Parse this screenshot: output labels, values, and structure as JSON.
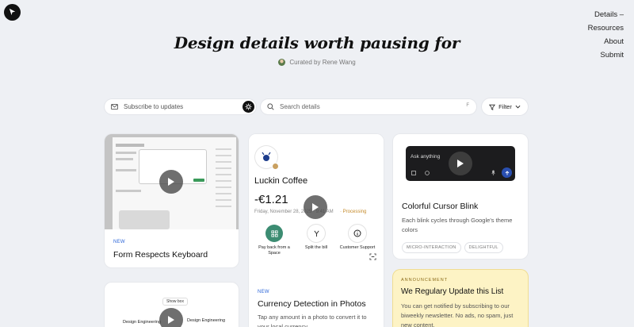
{
  "nav": {
    "details": "Details –",
    "resources": "Resources",
    "about": "About",
    "submit": "Submit"
  },
  "hero": {
    "title": "Design details worth pausing for",
    "curated": "Curated by Rene Wang"
  },
  "toolbar": {
    "subscribe_placeholder": "Subscribe to updates",
    "search_placeholder": "Search details",
    "search_shortcut": "F",
    "filter_label": "Filter"
  },
  "cards": {
    "form": {
      "badge": "NEW",
      "title": "Form Respects Keyboard"
    },
    "currency": {
      "merchant": "Luckin Coffee",
      "amount": "-€1.21",
      "datetime": "Friday, November 28, 2025 · 9:41 AM",
      "status": "· Processing",
      "actions": [
        "Pay back from a Space",
        "Split the bill",
        "Customer Support"
      ],
      "badge": "NEW",
      "title": "Currency Detection in Photos",
      "desc": "Tap any amount in a photo to convert it to your local currency."
    },
    "cursor": {
      "prompt": "Ask anything",
      "title": "Colorful Cursor Blink",
      "desc": "Each blink cycles through Google's theme colors",
      "tags": [
        "MICRO-INTERACTION",
        "DELIGHTFUL"
      ]
    },
    "announcement": {
      "label": "ANNOUNCEMENT",
      "title": "We Regulary Update this List",
      "desc": "You can get notified by subscribing to our biweekly newsletter. No ads, no spam, just new content."
    },
    "engineering": {
      "show_box": "Show box",
      "label_left": "Design Engineering",
      "label_right": "Design Engineering"
    }
  },
  "colors": {
    "accent_blue": "#2a64d8",
    "announcement_bg": "#fdf3c5",
    "processing": "#c48a2a"
  }
}
